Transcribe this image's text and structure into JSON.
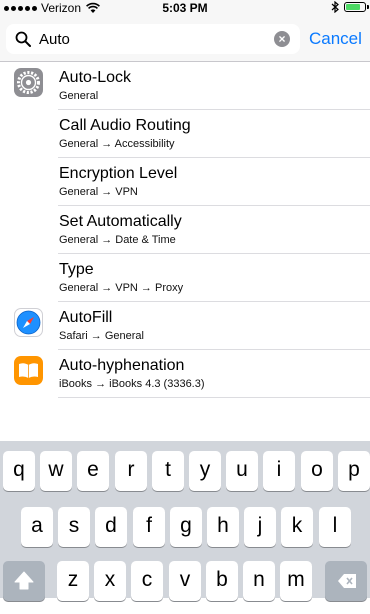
{
  "status_bar": {
    "carrier": "Verizon",
    "time": "5:03 PM",
    "battery_level": 0.8
  },
  "search": {
    "query": "Auto",
    "cancel_label": "Cancel"
  },
  "results": [
    {
      "title": "Auto-Lock",
      "path": "General",
      "icon": "gear-icon"
    },
    {
      "title": "Call Audio Routing",
      "path": "General → Accessibility",
      "icon": ""
    },
    {
      "title": "Encryption Level",
      "path": "General → VPN",
      "icon": ""
    },
    {
      "title": "Set Automatically",
      "path": "General → Date & Time",
      "icon": ""
    },
    {
      "title": "Type",
      "path": "General → VPN → Proxy",
      "icon": ""
    },
    {
      "title": "AutoFill",
      "path": "Safari → General",
      "icon": "safari-compass-icon"
    },
    {
      "title": "Auto-hyphenation",
      "path": "iBooks → iBooks 4.3 (3336.3)",
      "icon": "ibooks-book-icon"
    }
  ],
  "keyboard": {
    "row1": [
      "q",
      "w",
      "e",
      "r",
      "t",
      "y",
      "u",
      "i",
      "o",
      "p"
    ],
    "row2": [
      "a",
      "s",
      "d",
      "f",
      "g",
      "h",
      "j",
      "k",
      "l"
    ],
    "row3": [
      "z",
      "x",
      "c",
      "v",
      "b",
      "n",
      "m"
    ]
  }
}
